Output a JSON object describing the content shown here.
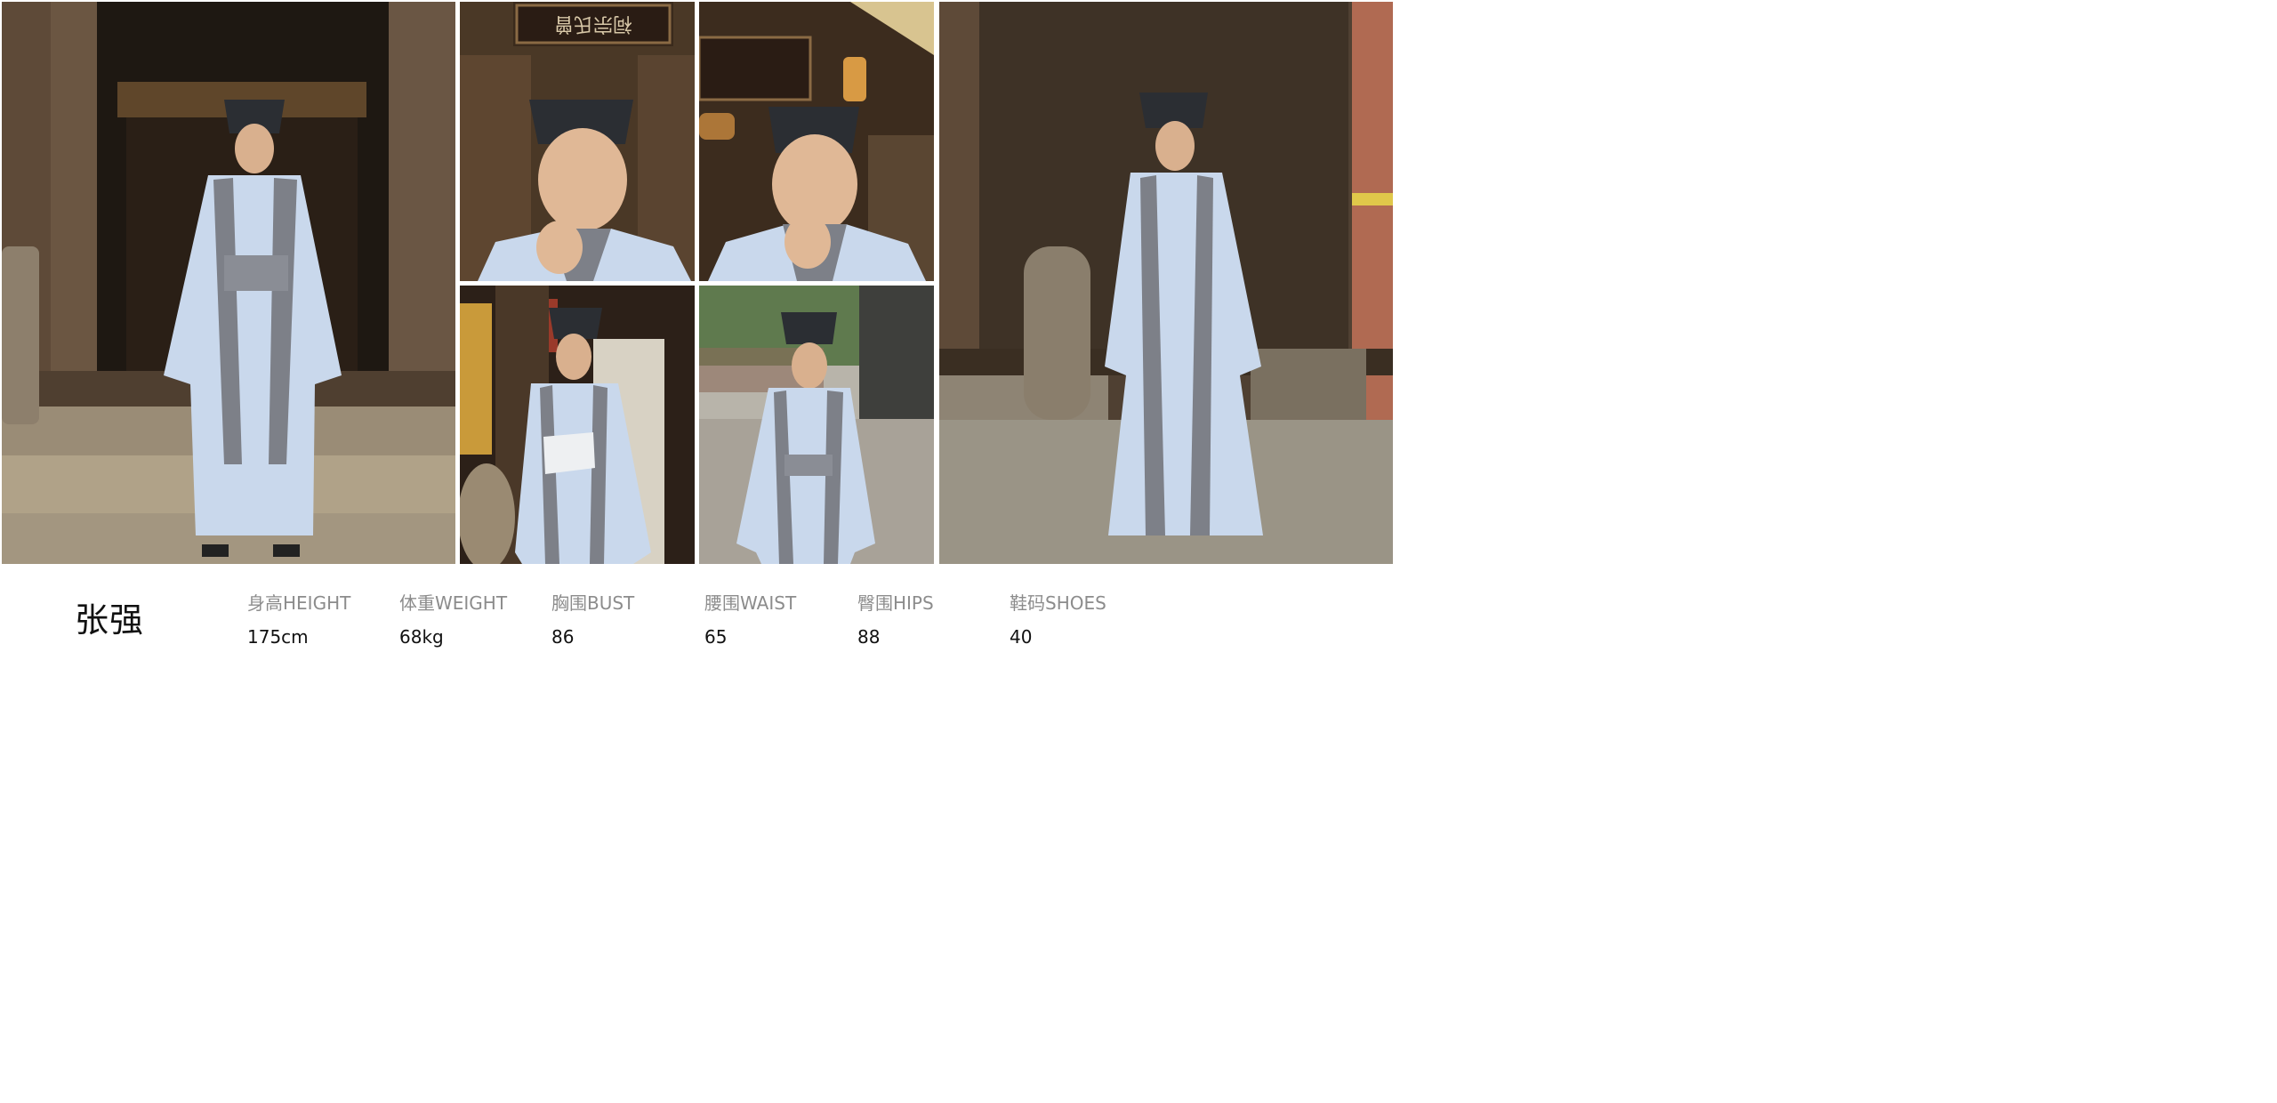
{
  "model": {
    "name": "张强"
  },
  "stats": {
    "height": {
      "label": "身高HEIGHT",
      "value": "175cm"
    },
    "weight": {
      "label": "体重WEIGHT",
      "value": "68kg"
    },
    "bust": {
      "label": "胸围BUST",
      "value": "86"
    },
    "waist": {
      "label": "腰围WAIST",
      "value": "65"
    },
    "hips": {
      "label": "臀围HIPS",
      "value": "88"
    },
    "shoes": {
      "label": "鞋码SHOES",
      "value": "40"
    }
  },
  "photos": {
    "signboard_text": "祠宗氏曾",
    "count": 6
  },
  "colors": {
    "background": "#ffffff",
    "label_gray": "#8c8c8c",
    "text_dark": "#111111",
    "robe_blue": "#c9d8ec",
    "robe_trim": "#7d8088",
    "hat_black": "#2b2e33",
    "wood_brown": "#5a4636",
    "stone_tan": "#a89b85"
  }
}
